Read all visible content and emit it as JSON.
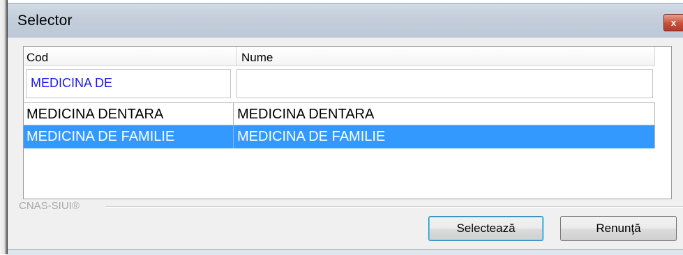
{
  "window": {
    "title": "Selector",
    "close_icon": "close-icon"
  },
  "grid": {
    "columns": [
      "Cod",
      "Nume"
    ],
    "filters": {
      "cod": "MEDICINA DE",
      "nume": ""
    },
    "rows": [
      {
        "cod": "MEDICINA DENTARA",
        "nume": "MEDICINA DENTARA",
        "selected": false
      },
      {
        "cod": "MEDICINA DE FAMILIE",
        "nume": "MEDICINA DE FAMILIE",
        "selected": true
      }
    ]
  },
  "footer": {
    "label": "CNAS-SIUI®"
  },
  "buttons": {
    "select_label": "Selectează",
    "cancel_label": "Renunţă"
  },
  "colors": {
    "selection": "#3399ff",
    "filter_text": "#1a1aee"
  }
}
